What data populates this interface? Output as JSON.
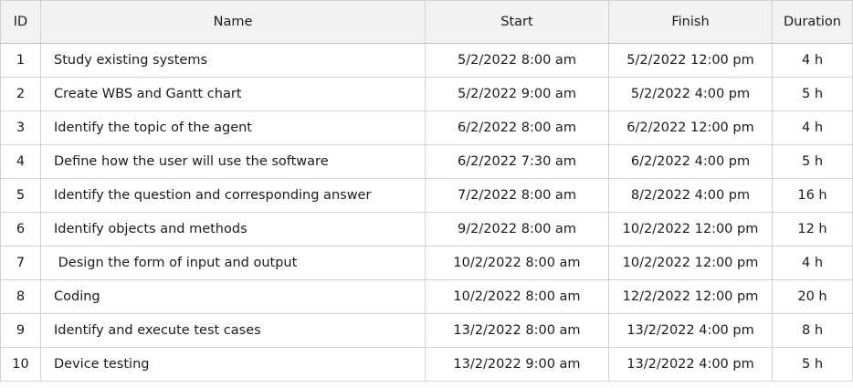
{
  "table": {
    "headers": {
      "id": "ID",
      "name": "Name",
      "start": "Start",
      "finish": "Finish",
      "duration": "Duration"
    },
    "rows": [
      {
        "id": "1",
        "name": "Study existing systems",
        "start": "5/2/2022 8:00 am",
        "finish": "5/2/2022 12:00 pm",
        "duration": "4 h"
      },
      {
        "id": "2",
        "name": "Create WBS and Gantt chart",
        "start": "5/2/2022 9:00 am",
        "finish": "5/2/2022 4:00 pm",
        "duration": "5 h"
      },
      {
        "id": "3",
        "name": "Identify the topic of the agent",
        "start": "6/2/2022 8:00 am",
        "finish": "6/2/2022 12:00 pm",
        "duration": "4 h"
      },
      {
        "id": "4",
        "name": "Define how the user will use the software",
        "start": "6/2/2022 7:30 am",
        "finish": "6/2/2022 4:00 pm",
        "duration": "5 h"
      },
      {
        "id": "5",
        "name": "Identify the question and corresponding answer",
        "start": "7/2/2022 8:00 am",
        "finish": "8/2/2022 4:00 pm",
        "duration": "16 h"
      },
      {
        "id": "6",
        "name": "Identify objects and methods",
        "start": "9/2/2022 8:00 am",
        "finish": "10/2/2022 12:00 pm",
        "duration": "12 h"
      },
      {
        "id": "7",
        "name": " Design the form of input and output",
        "start": "10/2/2022 8:00 am",
        "finish": "10/2/2022 12:00 pm",
        "duration": "4 h"
      },
      {
        "id": "8",
        "name": "Coding",
        "start": "10/2/2022 8:00 am",
        "finish": "12/2/2022 12:00 pm",
        "duration": "20 h"
      },
      {
        "id": "9",
        "name": "Identify and execute test cases",
        "start": "13/2/2022 8:00 am",
        "finish": "13/2/2022 4:00 pm",
        "duration": "8 h"
      },
      {
        "id": "10",
        "name": "Device testing",
        "start": "13/2/2022 9:00 am",
        "finish": "13/2/2022 4:00 pm",
        "duration": "5 h"
      }
    ]
  }
}
